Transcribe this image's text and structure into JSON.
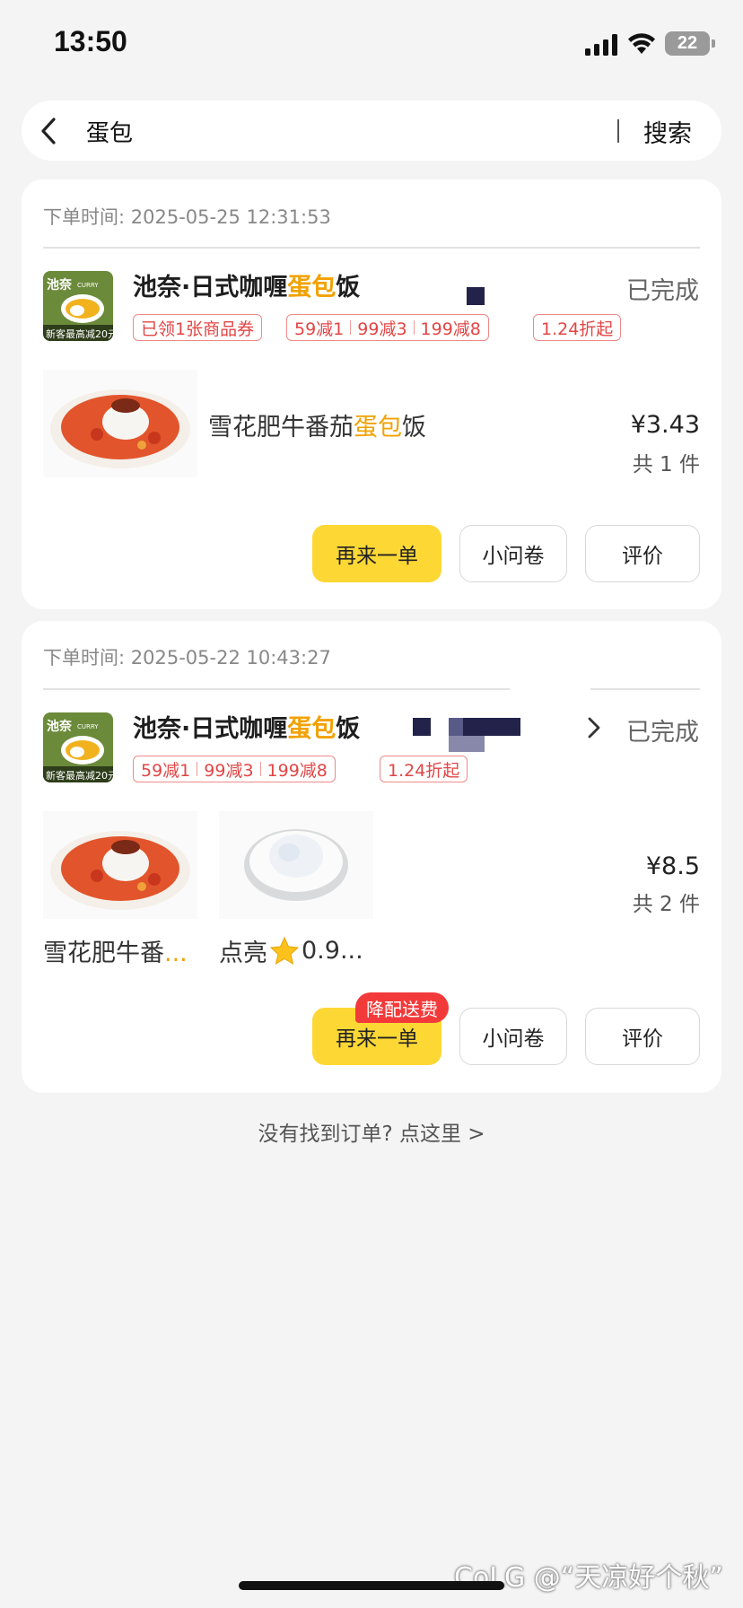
{
  "status_bar": {
    "time": "13:50",
    "battery": "22"
  },
  "search": {
    "query": "蛋包",
    "button": "搜索"
  },
  "orders": [
    {
      "time_label": "下单时间:",
      "time": "2025-05-25 12:31:53",
      "store_pre": "池奈·日式咖喱",
      "store_hl": "蛋包",
      "store_post": "饭",
      "status": "已完成",
      "logo_top": "池奈",
      "logo_sub": "CURRY",
      "logo_bottom": "新客最高减20元",
      "coupon": "已领1张商品券",
      "discounts": [
        "59减1",
        "99减3",
        "199减8"
      ],
      "rate": "1.24折起",
      "dish_pre": "雪花肥牛番茄",
      "dish_hl": "蛋包",
      "dish_post": "饭",
      "price": "¥3.43",
      "count": "共 1 件",
      "buttons": {
        "reorder": "再来一单",
        "survey": "小问卷",
        "review": "评价"
      }
    },
    {
      "time_label": "下单时间:",
      "time": "2025-05-22 10:43:27",
      "store_pre": "池奈·日式咖喱",
      "store_hl": "蛋包",
      "store_post": "饭",
      "status": "已完成",
      "logo_top": "池奈",
      "logo_sub": "CURRY",
      "logo_bottom": "新客最高减20元",
      "discounts": [
        "59减1",
        "99减3",
        "199减8"
      ],
      "rate": "1.24折起",
      "dish1_pre": "雪花肥牛番",
      "dish1_hl": "...",
      "dish2_pre": "点亮",
      "dish2_post": "0.9...",
      "price": "¥8.5",
      "count": "共 2 件",
      "badge": "降配送费",
      "buttons": {
        "reorder": "再来一单",
        "survey": "小问卷",
        "review": "评价"
      }
    }
  ],
  "not_found": "没有找到订单? 点这里 >",
  "watermark": "CoLG @“天凉好个秋”",
  "colors": {
    "accent_yellow": "#fdd835",
    "highlight": "#f2a100",
    "tag_red": "#e24545",
    "badge_red": "#f23a3a"
  }
}
